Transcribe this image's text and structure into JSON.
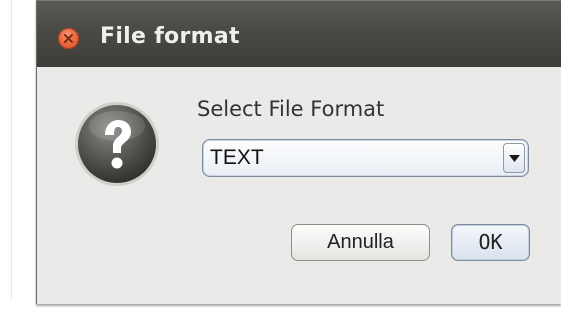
{
  "dialog": {
    "title": "File format",
    "prompt": "Select File Format",
    "format_select": {
      "selected": "TEXT"
    },
    "cancel_label": "Annulla",
    "ok_label": "OK",
    "icon": "question-icon"
  },
  "colors": {
    "titlebar": "#4a4945",
    "close_button": "#ec6a40",
    "dialog_background": "#eaeae8",
    "focus_accent": "#7d8a9e"
  }
}
